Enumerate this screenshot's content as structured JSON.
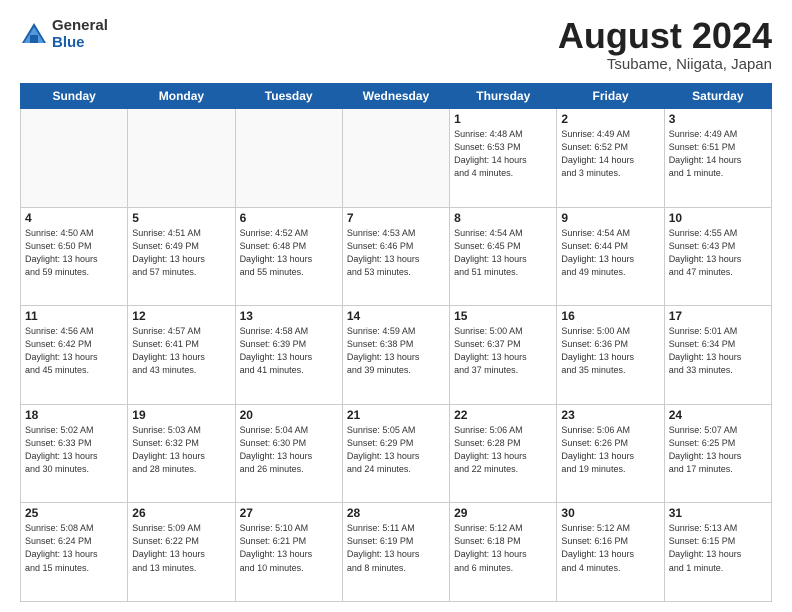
{
  "header": {
    "logo_general": "General",
    "logo_blue": "Blue",
    "main_title": "August 2024",
    "subtitle": "Tsubame, Niigata, Japan"
  },
  "calendar": {
    "days_of_week": [
      "Sunday",
      "Monday",
      "Tuesday",
      "Wednesday",
      "Thursday",
      "Friday",
      "Saturday"
    ],
    "weeks": [
      [
        {
          "day": "",
          "info": ""
        },
        {
          "day": "",
          "info": ""
        },
        {
          "day": "",
          "info": ""
        },
        {
          "day": "",
          "info": ""
        },
        {
          "day": "1",
          "info": "Sunrise: 4:48 AM\nSunset: 6:53 PM\nDaylight: 14 hours\nand 4 minutes."
        },
        {
          "day": "2",
          "info": "Sunrise: 4:49 AM\nSunset: 6:52 PM\nDaylight: 14 hours\nand 3 minutes."
        },
        {
          "day": "3",
          "info": "Sunrise: 4:49 AM\nSunset: 6:51 PM\nDaylight: 14 hours\nand 1 minute."
        }
      ],
      [
        {
          "day": "4",
          "info": "Sunrise: 4:50 AM\nSunset: 6:50 PM\nDaylight: 13 hours\nand 59 minutes."
        },
        {
          "day": "5",
          "info": "Sunrise: 4:51 AM\nSunset: 6:49 PM\nDaylight: 13 hours\nand 57 minutes."
        },
        {
          "day": "6",
          "info": "Sunrise: 4:52 AM\nSunset: 6:48 PM\nDaylight: 13 hours\nand 55 minutes."
        },
        {
          "day": "7",
          "info": "Sunrise: 4:53 AM\nSunset: 6:46 PM\nDaylight: 13 hours\nand 53 minutes."
        },
        {
          "day": "8",
          "info": "Sunrise: 4:54 AM\nSunset: 6:45 PM\nDaylight: 13 hours\nand 51 minutes."
        },
        {
          "day": "9",
          "info": "Sunrise: 4:54 AM\nSunset: 6:44 PM\nDaylight: 13 hours\nand 49 minutes."
        },
        {
          "day": "10",
          "info": "Sunrise: 4:55 AM\nSunset: 6:43 PM\nDaylight: 13 hours\nand 47 minutes."
        }
      ],
      [
        {
          "day": "11",
          "info": "Sunrise: 4:56 AM\nSunset: 6:42 PM\nDaylight: 13 hours\nand 45 minutes."
        },
        {
          "day": "12",
          "info": "Sunrise: 4:57 AM\nSunset: 6:41 PM\nDaylight: 13 hours\nand 43 minutes."
        },
        {
          "day": "13",
          "info": "Sunrise: 4:58 AM\nSunset: 6:39 PM\nDaylight: 13 hours\nand 41 minutes."
        },
        {
          "day": "14",
          "info": "Sunrise: 4:59 AM\nSunset: 6:38 PM\nDaylight: 13 hours\nand 39 minutes."
        },
        {
          "day": "15",
          "info": "Sunrise: 5:00 AM\nSunset: 6:37 PM\nDaylight: 13 hours\nand 37 minutes."
        },
        {
          "day": "16",
          "info": "Sunrise: 5:00 AM\nSunset: 6:36 PM\nDaylight: 13 hours\nand 35 minutes."
        },
        {
          "day": "17",
          "info": "Sunrise: 5:01 AM\nSunset: 6:34 PM\nDaylight: 13 hours\nand 33 minutes."
        }
      ],
      [
        {
          "day": "18",
          "info": "Sunrise: 5:02 AM\nSunset: 6:33 PM\nDaylight: 13 hours\nand 30 minutes."
        },
        {
          "day": "19",
          "info": "Sunrise: 5:03 AM\nSunset: 6:32 PM\nDaylight: 13 hours\nand 28 minutes."
        },
        {
          "day": "20",
          "info": "Sunrise: 5:04 AM\nSunset: 6:30 PM\nDaylight: 13 hours\nand 26 minutes."
        },
        {
          "day": "21",
          "info": "Sunrise: 5:05 AM\nSunset: 6:29 PM\nDaylight: 13 hours\nand 24 minutes."
        },
        {
          "day": "22",
          "info": "Sunrise: 5:06 AM\nSunset: 6:28 PM\nDaylight: 13 hours\nand 22 minutes."
        },
        {
          "day": "23",
          "info": "Sunrise: 5:06 AM\nSunset: 6:26 PM\nDaylight: 13 hours\nand 19 minutes."
        },
        {
          "day": "24",
          "info": "Sunrise: 5:07 AM\nSunset: 6:25 PM\nDaylight: 13 hours\nand 17 minutes."
        }
      ],
      [
        {
          "day": "25",
          "info": "Sunrise: 5:08 AM\nSunset: 6:24 PM\nDaylight: 13 hours\nand 15 minutes."
        },
        {
          "day": "26",
          "info": "Sunrise: 5:09 AM\nSunset: 6:22 PM\nDaylight: 13 hours\nand 13 minutes."
        },
        {
          "day": "27",
          "info": "Sunrise: 5:10 AM\nSunset: 6:21 PM\nDaylight: 13 hours\nand 10 minutes."
        },
        {
          "day": "28",
          "info": "Sunrise: 5:11 AM\nSunset: 6:19 PM\nDaylight: 13 hours\nand 8 minutes."
        },
        {
          "day": "29",
          "info": "Sunrise: 5:12 AM\nSunset: 6:18 PM\nDaylight: 13 hours\nand 6 minutes."
        },
        {
          "day": "30",
          "info": "Sunrise: 5:12 AM\nSunset: 6:16 PM\nDaylight: 13 hours\nand 4 minutes."
        },
        {
          "day": "31",
          "info": "Sunrise: 5:13 AM\nSunset: 6:15 PM\nDaylight: 13 hours\nand 1 minute."
        }
      ]
    ]
  }
}
